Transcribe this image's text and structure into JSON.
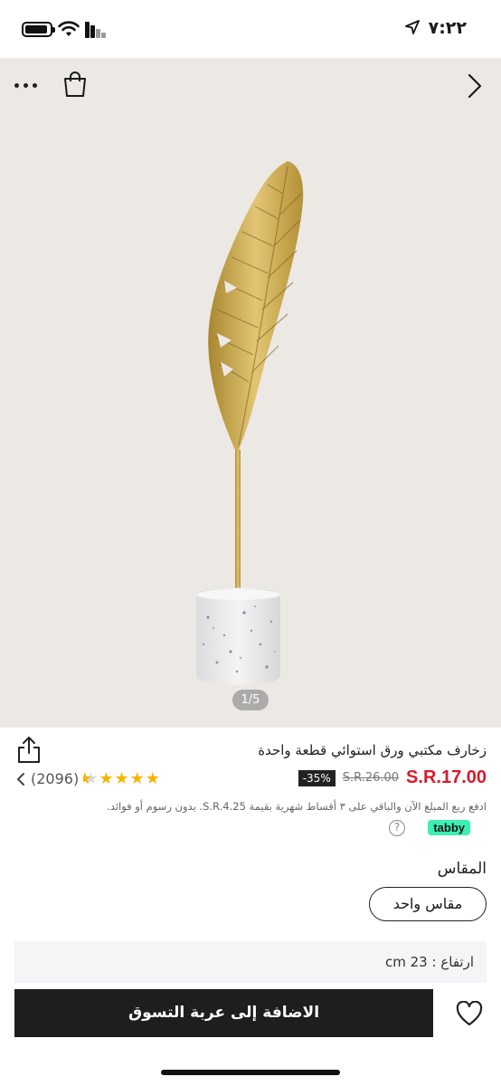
{
  "status_bar": {
    "time": "٧:٢٢",
    "icons": [
      "location-arrow-icon",
      "battery-icon",
      "wifi-icon",
      "signal-icon"
    ]
  },
  "gallery": {
    "pager": "1/5",
    "icons": [
      "more-icon",
      "shopping-bag-icon",
      "chevron-right-icon"
    ]
  },
  "product": {
    "title": "زخارف مكتبي ورق استوائي قطعة واحدة",
    "price_current": "S.R.17.00",
    "price_old": "S.R.26.00",
    "discount": "-35%",
    "rating_count": "(2096)",
    "rating_stars": 4.6,
    "tabby_text": "ادفع ربع المبلغ الآن والباقي على ٣ أقساط شهرية بقيمة S.R.4.25. بدون رسوم أو فوائد.",
    "tabby_badge": "tabby",
    "tabby_help": "?",
    "size_label": "المقاس",
    "size_option": "مقاس واحد",
    "spec": "ارتفاع : 23 cm"
  },
  "actions": {
    "add_to_cart": "الاضافة إلى عربة التسوق"
  },
  "colors": {
    "price_red": "#d81a2a",
    "star": "#f5b400",
    "tabby_green": "#3cf0b4",
    "cta_bg": "#1e1e1e",
    "gallery_bg": "#ece9e5"
  }
}
